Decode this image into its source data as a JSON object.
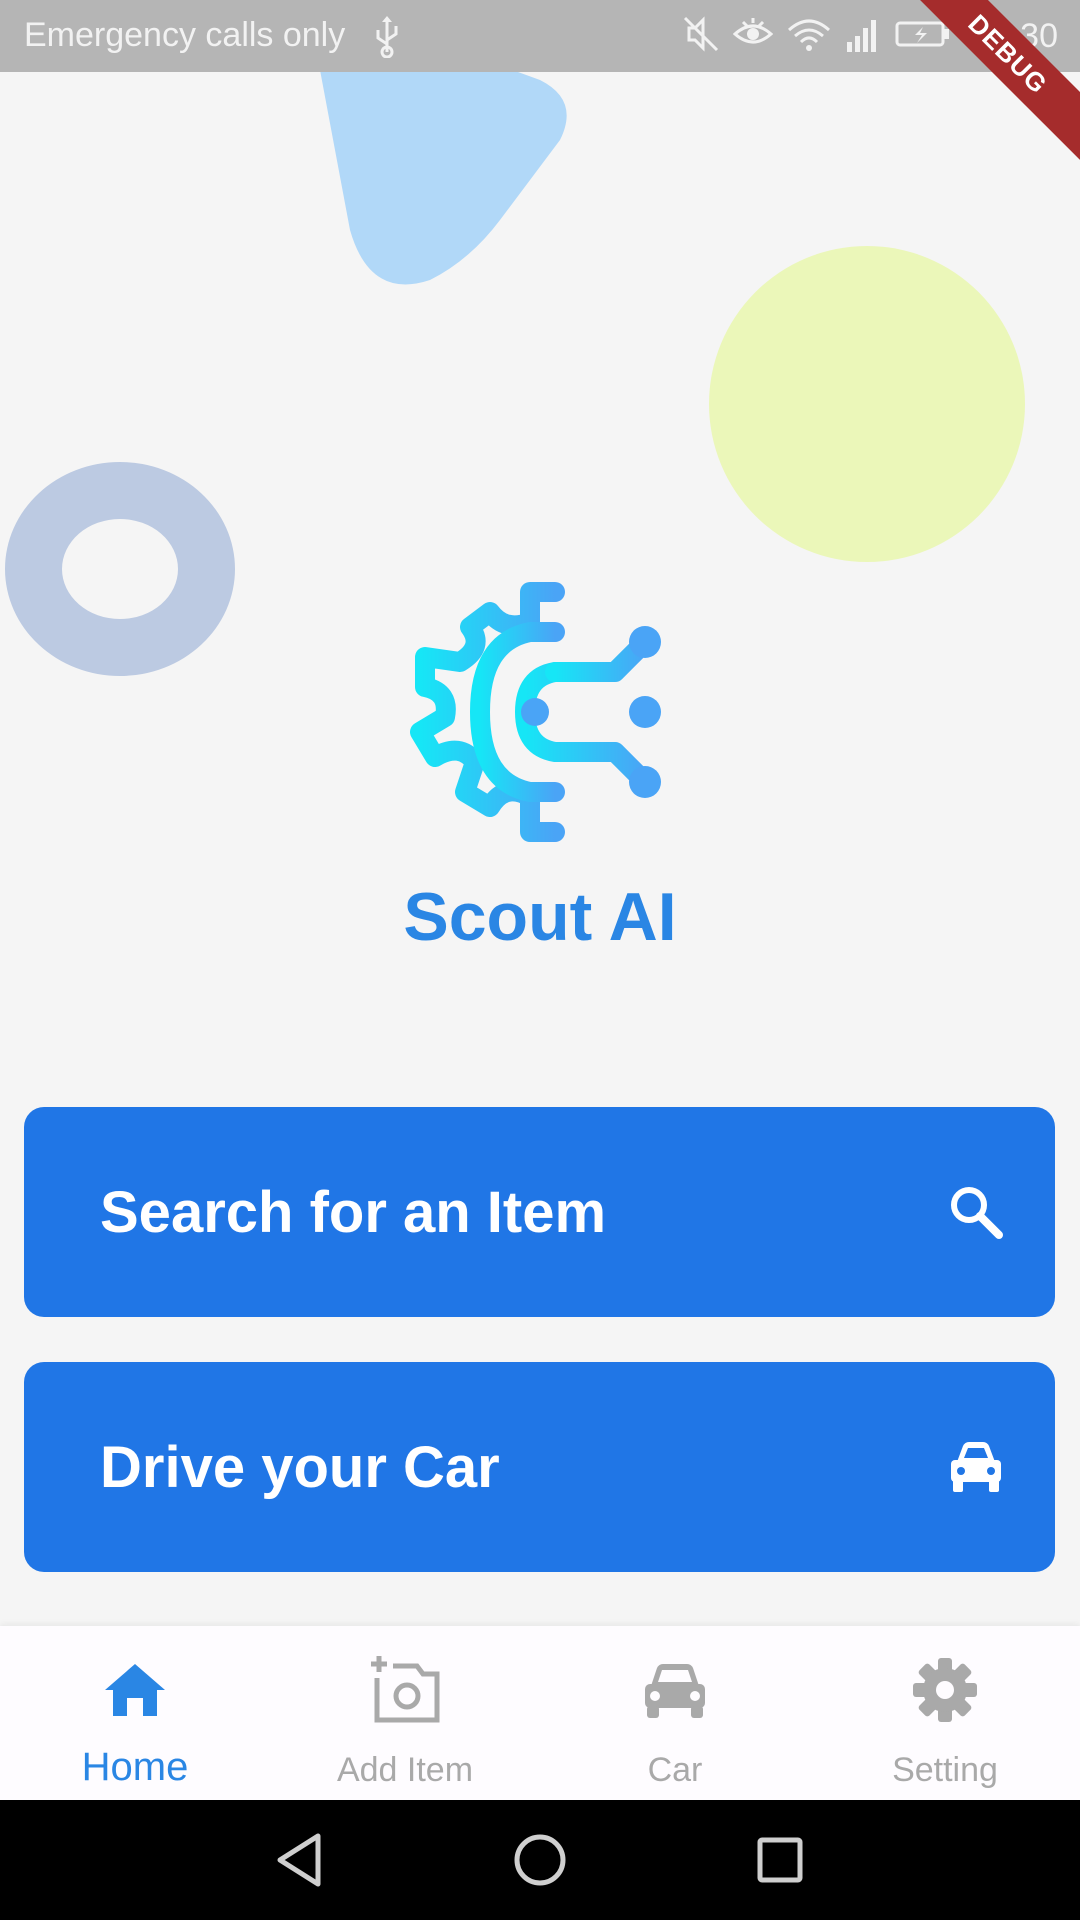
{
  "status_bar": {
    "carrier_text": "Emergency calls only",
    "time": "14:30",
    "icons": [
      "usb-icon",
      "mute-icon",
      "eye-icon",
      "wifi-icon",
      "signal-icon",
      "battery-icon"
    ]
  },
  "debug_banner": "DEBUG",
  "app": {
    "title": "Scout AI",
    "logo_icon": "gear-circuit-icon",
    "brand_color": "#2a86e4"
  },
  "actions": [
    {
      "label": "Search for an Item",
      "icon": "search-icon"
    },
    {
      "label": "Drive your Car",
      "icon": "car-icon"
    }
  ],
  "bottom_nav": {
    "items": [
      {
        "label": "Home",
        "icon": "home-icon",
        "active": true
      },
      {
        "label": "Add Item",
        "icon": "add-photo-icon",
        "active": false
      },
      {
        "label": "Car",
        "icon": "car-icon",
        "active": false
      },
      {
        "label": "Setting",
        "icon": "gear-icon",
        "active": false
      }
    ],
    "active_color": "#2a86e4",
    "inactive_color": "#a9a9a9"
  },
  "system_nav": [
    "back-icon",
    "home-circle-icon",
    "recents-icon"
  ],
  "colors": {
    "button_bg": "#2076e6",
    "status_bar": "#b5b5b5",
    "background": "#f5f5f5"
  }
}
